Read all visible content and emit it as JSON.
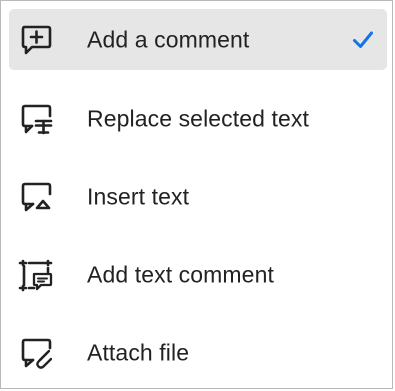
{
  "menu": {
    "items": [
      {
        "label": "Add a comment",
        "icon": "comment-plus-icon",
        "selected": true
      },
      {
        "label": "Replace selected text",
        "icon": "comment-replace-text-icon",
        "selected": false
      },
      {
        "label": "Insert text",
        "icon": "comment-insert-text-icon",
        "selected": false
      },
      {
        "label": "Add text comment",
        "icon": "text-comment-box-icon",
        "selected": false
      },
      {
        "label": "Attach file",
        "icon": "comment-attach-file-icon",
        "selected": false
      }
    ],
    "check_icon": "checkmark-icon",
    "colors": {
      "selected_background": "#e6e6e6",
      "check": "#1473e6",
      "text": "#222222",
      "icon": "#222222"
    }
  }
}
